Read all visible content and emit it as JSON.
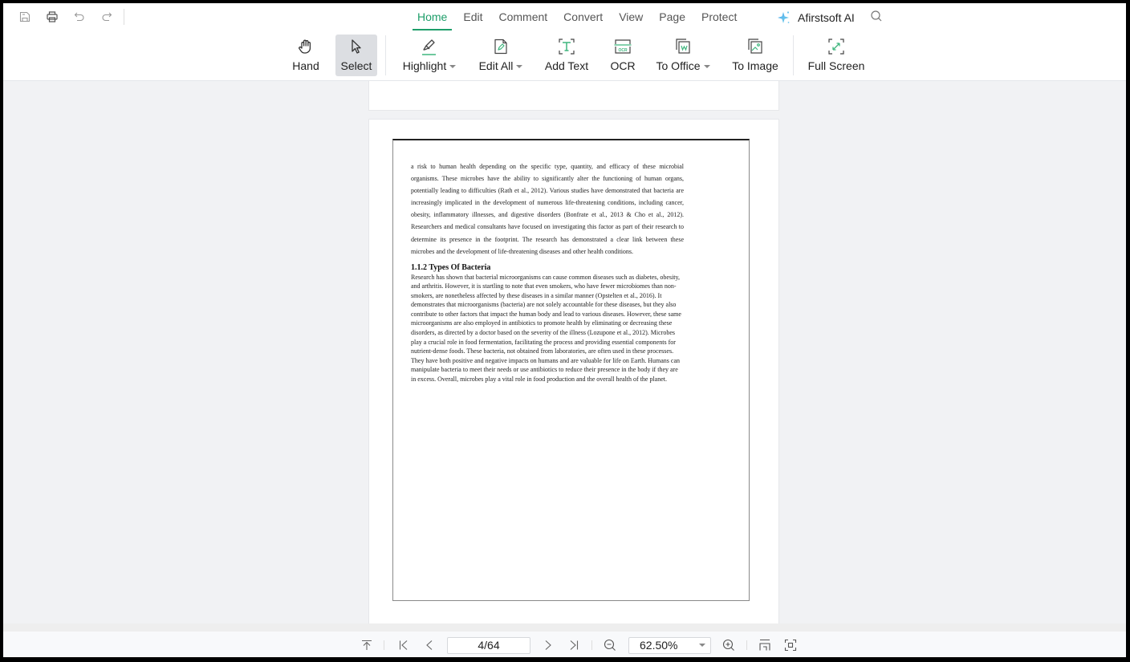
{
  "quick_access": {
    "icons": [
      "save-icon",
      "print-icon",
      "undo-icon",
      "redo-icon"
    ]
  },
  "menu_tabs": [
    {
      "label": "Home",
      "active": true
    },
    {
      "label": "Edit",
      "active": false
    },
    {
      "label": "Comment",
      "active": false
    },
    {
      "label": "Convert",
      "active": false
    },
    {
      "label": "View",
      "active": false
    },
    {
      "label": "Page",
      "active": false
    },
    {
      "label": "Protect",
      "active": false
    }
  ],
  "ai_button": {
    "label": "Afirstsoft AI",
    "icon": "sparkle-icon"
  },
  "search": {
    "icon": "search-icon"
  },
  "ribbon": {
    "hand": {
      "label": "Hand",
      "icon": "hand-icon"
    },
    "select": {
      "label": "Select",
      "icon": "cursor-arrow-icon",
      "selected": true
    },
    "highlight": {
      "label": "Highlight",
      "icon": "highlighter-icon",
      "has_dropdown": true
    },
    "edit_all": {
      "label": "Edit All",
      "icon": "edit-document-icon",
      "has_dropdown": true
    },
    "add_text": {
      "label": "Add Text",
      "icon": "add-text-icon"
    },
    "ocr": {
      "label": "OCR",
      "icon": "ocr-icon"
    },
    "to_office": {
      "label": "To Office",
      "icon": "to-office-icon",
      "has_dropdown": true
    },
    "to_image": {
      "label": "To Image",
      "icon": "to-image-icon"
    },
    "full_screen": {
      "label": "Full Screen",
      "icon": "full-screen-icon"
    }
  },
  "colors": {
    "accent": "#1e9e6a",
    "background": "#f1f2f4",
    "selected_bg": "#dcdee2"
  },
  "document": {
    "paragraph_1": "a risk to human health depending on the specific type, quantity, and efficacy of these microbial organisms. These microbes have the ability to significantly alter the functioning of human organs, potentially leading to difficulties (Rath et al., 2012). Various studies have demonstrated that bacteria are increasingly implicated in the development of numerous life-threatening conditions, including cancer, obesity, inflammatory illnesses, and digestive disorders (Bonfrate et al., 2013 & Cho et al., 2012). Researchers and medical consultants have focused on investigating this factor as part of their research to determine its presence in the footprint. The research has demonstrated a clear link between these microbes and the development of life-threatening diseases and other health conditions.",
    "heading": "1.1.2 Types Of Bacteria",
    "paragraph_2": "Research has shown that bacterial microorganisms can cause common diseases such as diabetes, obesity, and arthritis. However, it is startling to note that even smokers, who have fewer microbiomes than non-smokers, are nonetheless affected by these diseases in a similar manner (Opstelten et al., 2016). It demonstrates that microorganisms (bacteria) are not solely accountable for these diseases, but they also contribute to other factors that impact the human body and lead to various diseases. However, these same microorganisms are also employed in antibiotics to promote health by eliminating or decreasing these disorders, as directed by a doctor based on the severity of the illness (Lozupone et al., 2012). Microbes play a crucial role in food fermentation, facilitating the process and providing essential components for nutrient-dense foods. These bacteria, not obtained from laboratories, are often used in these processes. They have both positive and negative impacts on humans and are valuable for life on Earth. Humans can manipulate bacteria to meet their needs or use antibiotics to reduce their presence in the body if they are in excess. Overall, microbes play a vital role in food production and the overall health of the planet."
  },
  "navigation": {
    "current_page": 4,
    "total_pages": 64,
    "page_display": "4/64",
    "zoom_level": "62.50%",
    "icons": [
      "back-to-top-icon",
      "first-page-icon",
      "previous-page-icon",
      "next-page-icon",
      "last-page-icon",
      "zoom-out-icon",
      "zoom-in-icon",
      "fit-page-icon",
      "fit-width-icon"
    ]
  }
}
